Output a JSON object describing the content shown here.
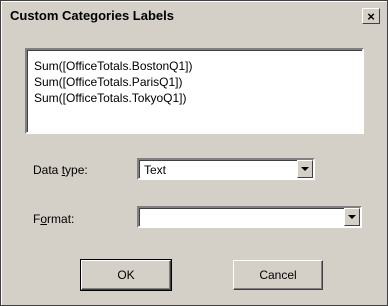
{
  "dialog": {
    "title": "Custom Categories Labels",
    "close_glyph": "×"
  },
  "expressions": [
    "Sum([OfficeTotals.BostonQ1])",
    "Sum([OfficeTotals.ParisQ1])",
    "Sum([OfficeTotals.TokyoQ1])"
  ],
  "data_type": {
    "label_pre": "Data ",
    "label_u": "t",
    "label_post": "ype:",
    "value": "Text"
  },
  "format": {
    "label_pre": "F",
    "label_u": "o",
    "label_post": "rmat:",
    "value": ""
  },
  "buttons": {
    "ok": "OK",
    "cancel": "Cancel"
  },
  "icons": {
    "close": "close-icon",
    "dropdown": "chevron-down-icon"
  }
}
